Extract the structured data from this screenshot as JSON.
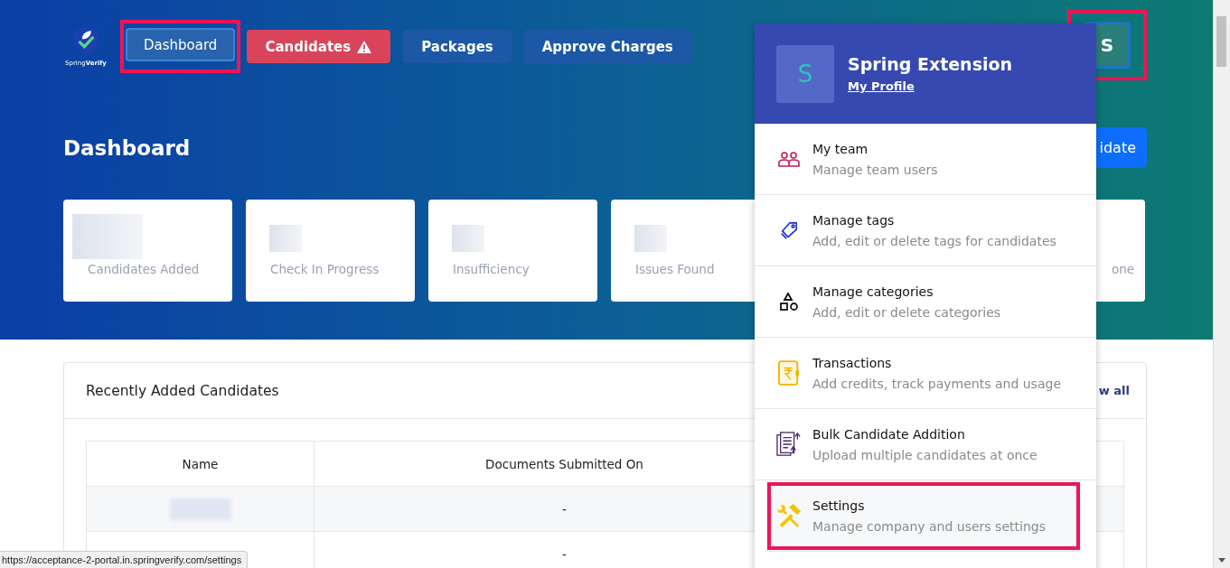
{
  "logo": {
    "text": "Spring**Verify**"
  },
  "nav": [
    {
      "label": "Dashboard",
      "kind": "plain",
      "selected": true,
      "highlighted": true
    },
    {
      "label": "Candidates",
      "kind": "warning",
      "selected": false,
      "highlighted": false
    },
    {
      "label": "Packages",
      "kind": "plain",
      "selected": false,
      "highlighted": false
    },
    {
      "label": "Approve Charges",
      "kind": "plain",
      "selected": false,
      "highlighted": false
    }
  ],
  "avatar": {
    "initial": "S",
    "highlighted": true
  },
  "page_title": "Dashboard",
  "header_button": {
    "label": "idate"
  },
  "stat_cards": [
    {
      "label": "Candidates Added",
      "value_redacted": true
    },
    {
      "label": "Check In Progress",
      "value_redacted": true
    },
    {
      "label": "Insufficiency",
      "value_redacted": true
    },
    {
      "label": "Issues Found",
      "value_redacted": true
    },
    {
      "label": "one"
    }
  ],
  "recent": {
    "title": "Recently Added Candidates",
    "link": "w all",
    "columns": [
      "Name",
      "Documents Submitted On"
    ],
    "rows": [
      {
        "name_redacted": true,
        "documents_submitted_on": "-"
      },
      {
        "name_redacted": false,
        "documents_submitted_on": "-"
      }
    ]
  },
  "profile_menu": {
    "initial": "S",
    "name": "Spring Extension",
    "profile_link": "My Profile",
    "items": [
      {
        "kind": "team",
        "title": "My team",
        "subtitle": "Manage team users",
        "highlighted": false
      },
      {
        "kind": "tags",
        "title": "Manage tags",
        "subtitle": "Add, edit or delete tags for candidates",
        "highlighted": false
      },
      {
        "kind": "categories",
        "title": "Manage categories",
        "subtitle": "Add, edit or delete categories",
        "highlighted": false
      },
      {
        "kind": "transactions",
        "title": "Transactions",
        "subtitle": "Add credits, track payments and usage",
        "highlighted": false
      },
      {
        "kind": "bulk",
        "title": "Bulk Candidate Addition",
        "subtitle": "Upload multiple candidates at once",
        "highlighted": false
      },
      {
        "kind": "settings",
        "title": "Settings",
        "subtitle": "Manage company and users settings",
        "highlighted": true
      }
    ]
  },
  "status_url": "https://acceptance-2-portal.in.springverify.com/settings"
}
